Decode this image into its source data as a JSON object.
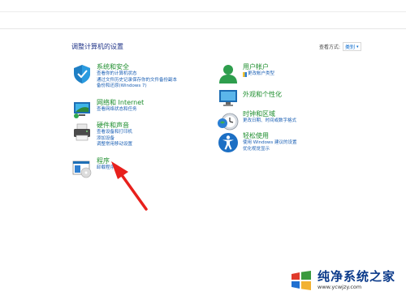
{
  "header": {
    "title": "调整计算机的设置",
    "view_by_label": "查看方式:",
    "view_by_value": "类别"
  },
  "left_categories": [
    {
      "title": "系统和安全",
      "icon": "shield-icon",
      "links": [
        "查看你的计算机状态",
        "通过文件历史记录保存你的文件备份副本",
        "备份和还原(Windows 7)"
      ]
    },
    {
      "title": "网络和 Internet",
      "icon": "network-icon",
      "links": [
        "查看网络状态和任务"
      ]
    },
    {
      "title": "硬件和声音",
      "icon": "printer-icon",
      "links": [
        "查看设备和打印机",
        "添加设备",
        "调整常用移动设置"
      ]
    },
    {
      "title": "程序",
      "icon": "programs-icon",
      "links": [
        "卸载程序"
      ]
    }
  ],
  "right_categories": [
    {
      "title": "用户帐户",
      "icon": "user-accounts-icon",
      "links": [
        "更改帐户类型"
      ]
    },
    {
      "title": "外观和个性化",
      "icon": "appearance-icon",
      "links": []
    },
    {
      "title": "时钟和区域",
      "icon": "clock-icon",
      "links": [
        "更改日期、时间或数字格式"
      ]
    },
    {
      "title": "轻松使用",
      "icon": "accessibility-icon",
      "links": [
        "使用 Windows 建议的设置",
        "优化视觉显示"
      ]
    }
  ],
  "watermark": {
    "title": "纯净系统之家",
    "url": "www.ycwjzy.com"
  },
  "colors": {
    "category_title": "#1e8e2e",
    "link": "#1a5fb4",
    "header_title": "#1e3287",
    "arrow": "#e8201c"
  }
}
